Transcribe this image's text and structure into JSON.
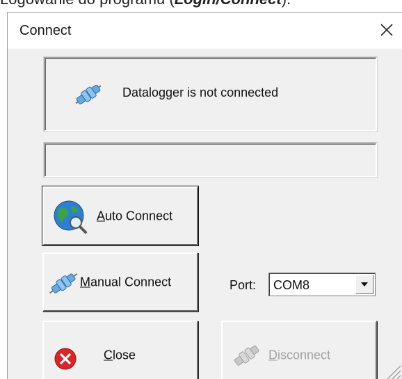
{
  "doc_caption": {
    "prefix": "Logowanie do programu (",
    "emphasis": "Login/Connect",
    "suffix": ")."
  },
  "dialog": {
    "title": "Connect",
    "status_text": "Datalogger is not connected",
    "auto_connect": {
      "accel": "A",
      "rest": "uto Connect"
    },
    "manual_connect": {
      "accel": "M",
      "rest": "anual Connect"
    },
    "close": {
      "accel": "C",
      "rest": "lose"
    },
    "disconnect": {
      "accel": "D",
      "rest": "isconnect"
    },
    "port_label": "Port:",
    "port_value": "COM8"
  },
  "icons": {
    "close_x": "close-icon",
    "plug": "plug-icon",
    "globe": "globe-search-icon",
    "error": "error-circle-icon",
    "dropdown": "chevron-down-icon"
  },
  "colors": {
    "dialog_bg": "#f0f0f0",
    "titlebar_bg": "#ffffff",
    "error_red": "#d9252a",
    "plug_blue": "#3b8fd6",
    "disabled_text": "#a3a3a3"
  }
}
